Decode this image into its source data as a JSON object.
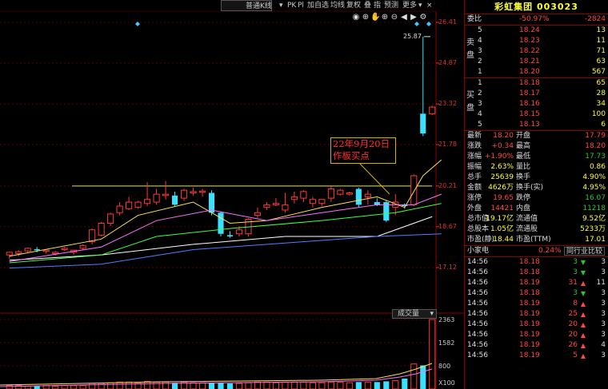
{
  "toolbar": {
    "menu": [
      "普通K线",
      "PK",
      "Pl",
      "加自选",
      "均线",
      "复权",
      "叠",
      "指",
      "预测",
      "更多"
    ]
  },
  "chart_data": {
    "type": "candlestick",
    "price_ticks": [
      "26.41",
      "24.87",
      "23.32",
      "21.78",
      "20.21",
      "18.67",
      "17.12"
    ],
    "price_range": [
      17.12,
      26.41
    ],
    "peak_label": "25.87",
    "annotation": "22年9月20日\n作板买点",
    "horizontal_line": 20.21,
    "volume_ticks": [
      "2363",
      "1582",
      "800",
      "X100"
    ],
    "volume_label": "成交量",
    "candles": [
      [
        17.6,
        17.7,
        17.45,
        17.72,
        "up"
      ],
      [
        17.65,
        17.72,
        17.55,
        17.78,
        "up"
      ],
      [
        17.75,
        17.85,
        17.7,
        17.88,
        "up"
      ],
      [
        17.8,
        17.82,
        17.7,
        17.9,
        "down"
      ],
      [
        17.75,
        17.78,
        17.65,
        17.82,
        "up"
      ],
      [
        17.65,
        17.7,
        17.58,
        17.74,
        "up"
      ],
      [
        17.8,
        17.85,
        17.75,
        17.9,
        "up"
      ],
      [
        17.7,
        17.78,
        17.62,
        17.8,
        "up"
      ],
      [
        17.85,
        17.95,
        17.78,
        18.0,
        "up"
      ],
      [
        18.1,
        18.55,
        18.0,
        18.6,
        "up"
      ],
      [
        18.35,
        18.8,
        18.3,
        18.85,
        "up"
      ],
      [
        18.8,
        19.15,
        18.7,
        19.2,
        "up"
      ],
      [
        19.2,
        19.45,
        19.1,
        19.6,
        "up"
      ],
      [
        19.35,
        19.6,
        19.3,
        19.8,
        "up"
      ],
      [
        19.4,
        19.6,
        19.35,
        19.65,
        "up"
      ],
      [
        19.7,
        19.55,
        19.45,
        20.35,
        "up"
      ],
      [
        19.6,
        19.9,
        19.5,
        20.1,
        "up"
      ],
      [
        19.85,
        19.9,
        19.7,
        20.4,
        "up"
      ],
      [
        19.5,
        19.85,
        19.45,
        20.0,
        "down"
      ],
      [
        19.75,
        20.05,
        19.65,
        20.1,
        "up"
      ],
      [
        19.95,
        20.0,
        19.85,
        20.15,
        "up"
      ],
      [
        20.0,
        20.02,
        19.8,
        20.1,
        "up"
      ],
      [
        19.95,
        19.2,
        19.1,
        20.05,
        "down"
      ],
      [
        19.2,
        18.4,
        18.3,
        19.25,
        "down"
      ],
      [
        18.35,
        18.3,
        18.25,
        18.5,
        "down"
      ],
      [
        18.55,
        18.4,
        18.3,
        18.7,
        "up"
      ],
      [
        18.4,
        18.95,
        18.3,
        19.0,
        "up"
      ],
      [
        19.2,
        19.1,
        19.0,
        19.4,
        "up"
      ],
      [
        19.5,
        19.4,
        19.3,
        19.6,
        "up"
      ],
      [
        19.55,
        19.5,
        19.45,
        19.75,
        "up"
      ],
      [
        19.3,
        19.5,
        19.2,
        19.95,
        "up"
      ],
      [
        19.7,
        19.8,
        19.55,
        20.0,
        "up"
      ],
      [
        19.75,
        20.0,
        19.6,
        20.05,
        "up"
      ],
      [
        19.55,
        19.7,
        19.4,
        19.8,
        "up"
      ],
      [
        19.55,
        19.7,
        19.45,
        19.7,
        "up"
      ],
      [
        19.75,
        20.1,
        19.6,
        20.2,
        "up"
      ],
      [
        19.9,
        20.05,
        19.85,
        20.1,
        "up"
      ],
      [
        19.9,
        19.95,
        19.85,
        20.0,
        "up"
      ],
      [
        20.1,
        19.5,
        19.4,
        20.15,
        "down"
      ],
      [
        19.8,
        19.9,
        19.5,
        20.05,
        "up"
      ],
      [
        19.6,
        19.5,
        19.45,
        19.75,
        "down"
      ],
      [
        19.6,
        18.9,
        18.85,
        19.65,
        "down"
      ],
      [
        19.4,
        19.6,
        19.1,
        19.9,
        "up"
      ],
      [
        19.45,
        19.5,
        19.35,
        19.55,
        "down"
      ],
      [
        19.5,
        20.6,
        19.45,
        20.65,
        "up"
      ],
      [
        22.95,
        22.2,
        22.1,
        25.87,
        "down"
      ],
      [
        22.95,
        23.2,
        22.9,
        23.25,
        "up"
      ]
    ],
    "volumes": [
      0.05,
      0.05,
      0.04,
      0.04,
      0.05,
      0.04,
      0.05,
      0.05,
      0.05,
      0.08,
      0.08,
      0.09,
      0.1,
      0.1,
      0.09,
      0.11,
      0.1,
      0.1,
      0.09,
      0.1,
      0.09,
      0.09,
      0.09,
      0.09,
      0.08,
      0.08,
      0.09,
      0.1,
      0.1,
      0.09,
      0.1,
      0.1,
      0.1,
      0.09,
      0.09,
      0.1,
      0.1,
      0.09,
      0.1,
      0.1,
      0.1,
      0.11,
      0.12,
      0.15,
      0.36,
      0.34,
      1.0
    ],
    "moving_averages": [
      {
        "color": "#ffffff",
        "points": [
          [
            0,
            17.4
          ],
          [
            10,
            17.6
          ],
          [
            20,
            18.0
          ],
          [
            30,
            18.3
          ],
          [
            40,
            18.3
          ],
          [
            46,
            19.05
          ]
        ]
      },
      {
        "color": "#ffe050",
        "points": [
          [
            0,
            17.55
          ],
          [
            10,
            18.2
          ],
          [
            14,
            19.1
          ],
          [
            20,
            19.6
          ],
          [
            24,
            18.8
          ],
          [
            28,
            18.9
          ],
          [
            34,
            19.4
          ],
          [
            40,
            19.8
          ],
          [
            43,
            19.4
          ],
          [
            45,
            20.6
          ],
          [
            47,
            21.2
          ]
        ]
      },
      {
        "color": "#ff70ff",
        "points": [
          [
            0,
            17.35
          ],
          [
            10,
            17.9
          ],
          [
            16,
            18.9
          ],
          [
            22,
            19.3
          ],
          [
            28,
            18.9
          ],
          [
            34,
            19.2
          ],
          [
            40,
            19.5
          ],
          [
            44,
            19.5
          ],
          [
            47,
            19.9
          ]
        ]
      },
      {
        "color": "#40ff40",
        "points": [
          [
            0,
            17.3
          ],
          [
            10,
            17.6
          ],
          [
            16,
            18.3
          ],
          [
            24,
            18.6
          ],
          [
            34,
            18.9
          ],
          [
            42,
            19.2
          ],
          [
            47,
            19.55
          ]
        ]
      },
      {
        "color": "#5080ff",
        "points": [
          [
            0,
            17.1
          ],
          [
            10,
            17.25
          ],
          [
            20,
            17.8
          ],
          [
            30,
            18.05
          ],
          [
            40,
            18.3
          ],
          [
            47,
            18.4
          ]
        ]
      }
    ]
  },
  "panel": {
    "title": "彩虹集团 003023",
    "wei_bi": {
      "label": "委比",
      "value": "-50.97%",
      "diff": "-2824"
    },
    "sell_label": [
      "卖",
      "盘"
    ],
    "buy_label": [
      "买",
      "盘"
    ],
    "sells": [
      {
        "level": "5",
        "price": "18.24",
        "vol": "13"
      },
      {
        "level": "4",
        "price": "18.23",
        "vol": "11"
      },
      {
        "level": "3",
        "price": "18.22",
        "vol": "71"
      },
      {
        "level": "2",
        "price": "18.21",
        "vol": "63"
      },
      {
        "level": "1",
        "price": "18.20",
        "vol": "567"
      }
    ],
    "buys": [
      {
        "level": "1",
        "price": "18.18",
        "vol": "65"
      },
      {
        "level": "2",
        "price": "18.17",
        "vol": "28"
      },
      {
        "level": "3",
        "price": "18.16",
        "vol": "34"
      },
      {
        "level": "4",
        "price": "18.15",
        "vol": "100"
      },
      {
        "level": "5",
        "price": "18.13",
        "vol": "6"
      }
    ],
    "stats": [
      {
        "l1": "最新",
        "v1": "18.20",
        "c1": "red",
        "l2": "开盘",
        "v2": "17.79",
        "c2": "red"
      },
      {
        "l1": "涨跌",
        "v1": "+0.34",
        "c1": "red",
        "l2": "最高",
        "v2": "18.20",
        "c2": "red"
      },
      {
        "l1": "涨幅",
        "v1": "+1.90%",
        "c1": "red",
        "l2": "最低",
        "v2": "17.73",
        "c2": "grn"
      },
      {
        "l1": "振幅",
        "v1": "2.63%",
        "c1": "yel",
        "l2": "量比",
        "v2": "0.86",
        "c2": "yel"
      },
      {
        "l1": "总手",
        "v1": "25639",
        "c1": "yel",
        "l2": "换手",
        "v2": "4.90%",
        "c2": "yel"
      },
      {
        "l1": "金额",
        "v1": "4626万",
        "c1": "yel",
        "l2": "换手(实)",
        "v2": "4.95%",
        "c2": "yel"
      },
      {
        "l1": "涨停",
        "v1": "19.65",
        "c1": "red",
        "l2": "跌停",
        "v2": "16.07",
        "c2": "grn"
      },
      {
        "l1": "外盘",
        "v1": "14421",
        "c1": "red",
        "l2": "内盘",
        "v2": "11218",
        "c2": "grn"
      },
      {
        "l1": "总市值",
        "v1": "19.17亿",
        "c1": "yel",
        "l2": "流通值",
        "v2": "9.52亿",
        "c2": "yel"
      },
      {
        "l1": "总股本",
        "v1": "1.05亿",
        "c1": "yel",
        "l2": "流通股",
        "v2": "5233万",
        "c2": "yel"
      },
      {
        "l1": "市盈(静)",
        "v1": "18.44",
        "c1": "yel",
        "l2": "市盈(TTM)",
        "v2": "17.01",
        "c2": "yel"
      }
    ],
    "sector": {
      "name": "小家电",
      "pct": "0.24%",
      "compare": "同行业比较"
    },
    "ticks": [
      {
        "time": "14:56",
        "price": "18.18",
        "vol": "3",
        "dir": "down",
        "cnt": "3"
      },
      {
        "time": "14:56",
        "price": "18.18",
        "vol": "3",
        "dir": "down",
        "cnt": "3"
      },
      {
        "time": "14:56",
        "price": "18.19",
        "vol": "31",
        "dir": "up",
        "cnt": "11"
      },
      {
        "time": "14:56",
        "price": "18.18",
        "vol": "3",
        "dir": "down",
        "cnt": "3"
      },
      {
        "time": "14:56",
        "price": "18.19",
        "vol": "8",
        "dir": "up",
        "cnt": "3"
      },
      {
        "time": "14:56",
        "price": "18.19",
        "vol": "25",
        "dir": "up",
        "cnt": "3"
      },
      {
        "time": "14:56",
        "price": "18.19",
        "vol": "20",
        "dir": "up",
        "cnt": "3"
      },
      {
        "time": "14:56",
        "price": "18.19",
        "vol": "20",
        "dir": "up",
        "cnt": "3"
      },
      {
        "time": "14:56",
        "price": "18.19",
        "vol": "26",
        "dir": "up",
        "cnt": "4"
      },
      {
        "time": "14:56",
        "price": "18.19",
        "vol": "5",
        "dir": "up",
        "cnt": "3"
      }
    ]
  }
}
